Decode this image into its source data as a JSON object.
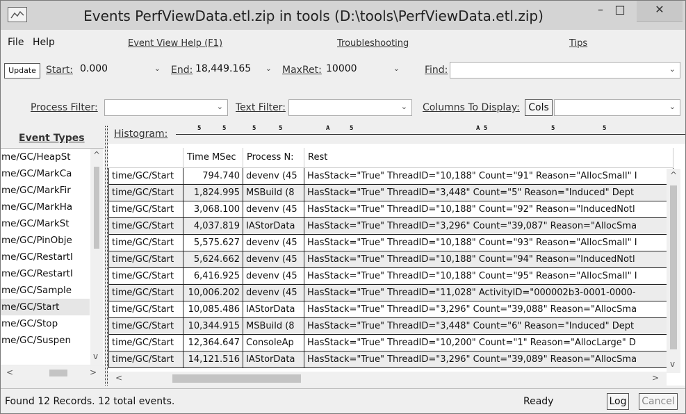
{
  "window": {
    "title": "Events PerfViewData.etl.zip in tools (D:\\tools\\PerfViewData.etl.zip)",
    "minimize_glyph": "–",
    "maximize_glyph": "□",
    "close_glyph": "✕",
    "icon": "chart-window-icon"
  },
  "menu": {
    "file": "File",
    "help": "Help",
    "event_view_help": "Event View Help (F1)",
    "troubleshooting": "Troubleshooting",
    "tips": "Tips"
  },
  "controls": {
    "update_label": "Update",
    "start_label": "Start:",
    "start_value": "0.000",
    "end_label": "End:",
    "end_value": "18,449.165",
    "maxret_label": "MaxRet:",
    "maxret_value": "10000",
    "find_label": "Find:",
    "find_value": "",
    "process_filter_label": "Process Filter:",
    "process_filter_value": "",
    "text_filter_label": "Text Filter:",
    "text_filter_value": "",
    "columns_label": "Columns To Display:",
    "cols_button": "Cols",
    "columns_value": "",
    "dropdown_glyph": "⌄"
  },
  "event_types": {
    "header": "Event Types",
    "items": [
      "me/GC/HeapSt",
      "me/GC/MarkCa",
      "me/GC/MarkFir",
      "me/GC/MarkHa",
      "me/GC/MarkSt",
      "me/GC/PinObje",
      "me/GC/RestartI",
      "me/GC/RestartI",
      "me/GC/Sample",
      "me/GC/Start",
      "me/GC/Stop",
      "me/GC/Suspen"
    ],
    "selected_index": 9
  },
  "histogram": {
    "label": "Histogram:",
    "marks": [
      "5",
      "5",
      "5",
      "5",
      "A",
      "5",
      "A 5",
      "5",
      "5"
    ]
  },
  "grid": {
    "columns": [
      "",
      "Time MSec",
      "Process N:",
      "Rest"
    ],
    "rows": [
      {
        "event": "time/GC/Start",
        "time": "794.740",
        "process": "devenv (45",
        "rest": "HasStack=\"True\" ThreadID=\"10,188\" Count=\"91\" Reason=\"AllocSmall\" I"
      },
      {
        "event": "time/GC/Start",
        "time": "1,824.995",
        "process": "MSBuild (8",
        "rest": "HasStack=\"True\" ThreadID=\"3,448\" Count=\"5\" Reason=\"Induced\" Dept"
      },
      {
        "event": "time/GC/Start",
        "time": "3,068.100",
        "process": "devenv (45",
        "rest": "HasStack=\"True\" ThreadID=\"10,188\" Count=\"92\" Reason=\"InducedNotl"
      },
      {
        "event": "time/GC/Start",
        "time": "4,037.819",
        "process": "IAStorData",
        "rest": "HasStack=\"True\" ThreadID=\"3,296\" Count=\"39,087\" Reason=\"AllocSma"
      },
      {
        "event": "time/GC/Start",
        "time": "5,575.627",
        "process": "devenv (45",
        "rest": "HasStack=\"True\" ThreadID=\"10,188\" Count=\"93\" Reason=\"AllocSmall\" I"
      },
      {
        "event": "time/GC/Start",
        "time": "5,624.662",
        "process": "devenv (45",
        "rest": "HasStack=\"True\" ThreadID=\"10,188\" Count=\"94\" Reason=\"InducedNotl"
      },
      {
        "event": "time/GC/Start",
        "time": "6,416.925",
        "process": "devenv (45",
        "rest": "HasStack=\"True\" ThreadID=\"10,188\" Count=\"95\" Reason=\"AllocSmall\" I"
      },
      {
        "event": "time/GC/Start",
        "time": "10,006.202",
        "process": "devenv (45",
        "rest": "HasStack=\"True\" ThreadID=\"11,028\" ActivityID=\"000002b3-0001-0000-"
      },
      {
        "event": "time/GC/Start",
        "time": "10,085.486",
        "process": "IAStorData",
        "rest": "HasStack=\"True\" ThreadID=\"3,296\" Count=\"39,088\" Reason=\"AllocSma"
      },
      {
        "event": "time/GC/Start",
        "time": "10,344.915",
        "process": "MSBuild (8",
        "rest": "HasStack=\"True\" ThreadID=\"3,448\" Count=\"6\" Reason=\"Induced\" Dept"
      },
      {
        "event": "time/GC/Start",
        "time": "12,364.647",
        "process": "ConsoleAp",
        "rest": "HasStack=\"True\" ThreadID=\"10,200\" Count=\"1\" Reason=\"AllocLarge\" D"
      },
      {
        "event": "time/GC/Start",
        "time": "14,121.516",
        "process": "IAStorData",
        "rest": "HasStack=\"True\" ThreadID=\"3,296\" Count=\"39,089\" Reason=\"AllocSma"
      }
    ]
  },
  "status": {
    "records": "Found 12 Records.  12 total events.",
    "ready": "Ready",
    "log_button": "Log",
    "cancel_button": "Cancel"
  }
}
